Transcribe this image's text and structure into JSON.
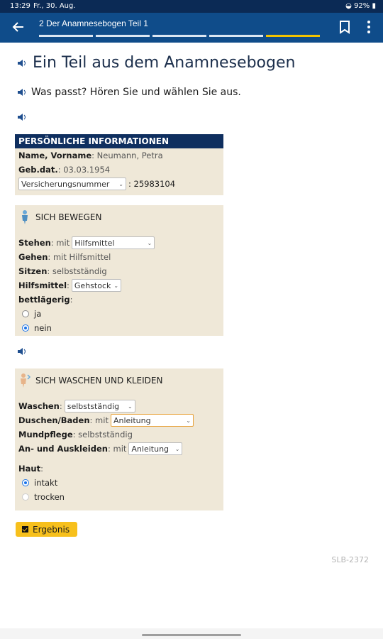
{
  "status_bar": {
    "time": "13:29",
    "date": "Fr., 30. Aug.",
    "battery": "92%"
  },
  "app_bar": {
    "title": "2 Der Anamnesebogen Teil 1",
    "progress": {
      "segments": 5,
      "active_index": 4
    },
    "accent_color": "#0f4c8a",
    "progress_color": "#f3c300"
  },
  "heading": "Ein Teil aus dem Anamnesebogen",
  "instruction": "Was passt? Hören Sie und wählen Sie aus.",
  "personal": {
    "title": "PERSÖNLICHE INFORMATIONEN",
    "name_label": "Name, Vorname",
    "name_value": "Neumann, Petra",
    "dob_label": "Geb.dat.",
    "dob_value": "03.03.1954",
    "insurance_select": "Versicherungsnummer",
    "insurance_value": ": 25983104"
  },
  "moving": {
    "title": "SICH BEWEGEN",
    "stehen_label": "Stehen",
    "stehen_pre": ": mit",
    "stehen_select": "Hilfsmittel",
    "gehen_label": "Gehen",
    "gehen_value": ": mit Hilfsmittel",
    "sitzen_label": "Sitzen",
    "sitzen_value": ": selbstständig",
    "hilfsmittel_label": "Hilfsmittel",
    "hilfsmittel_select": "Gehstock",
    "bett_label": "bettlägerig",
    "options": [
      "ja",
      "nein"
    ],
    "selected": "nein"
  },
  "washing": {
    "title": "SICH WASCHEN UND KLEIDEN",
    "waschen_label": "Waschen",
    "waschen_select": "selbstständig",
    "duschen_label": "Duschen/Baden",
    "duschen_pre": ": mit",
    "duschen_select": "Anleitung",
    "mund_label": "Mundpflege",
    "mund_value": ": selbstständig",
    "kleiden_label": "An- und Auskleiden",
    "kleiden_pre": ": mit",
    "kleiden_select": "Anleitung",
    "haut_label": "Haut",
    "options": [
      "intakt",
      "trocken"
    ],
    "selected": "intakt"
  },
  "result_button": "Ergebnis",
  "code": "SLB-2372"
}
